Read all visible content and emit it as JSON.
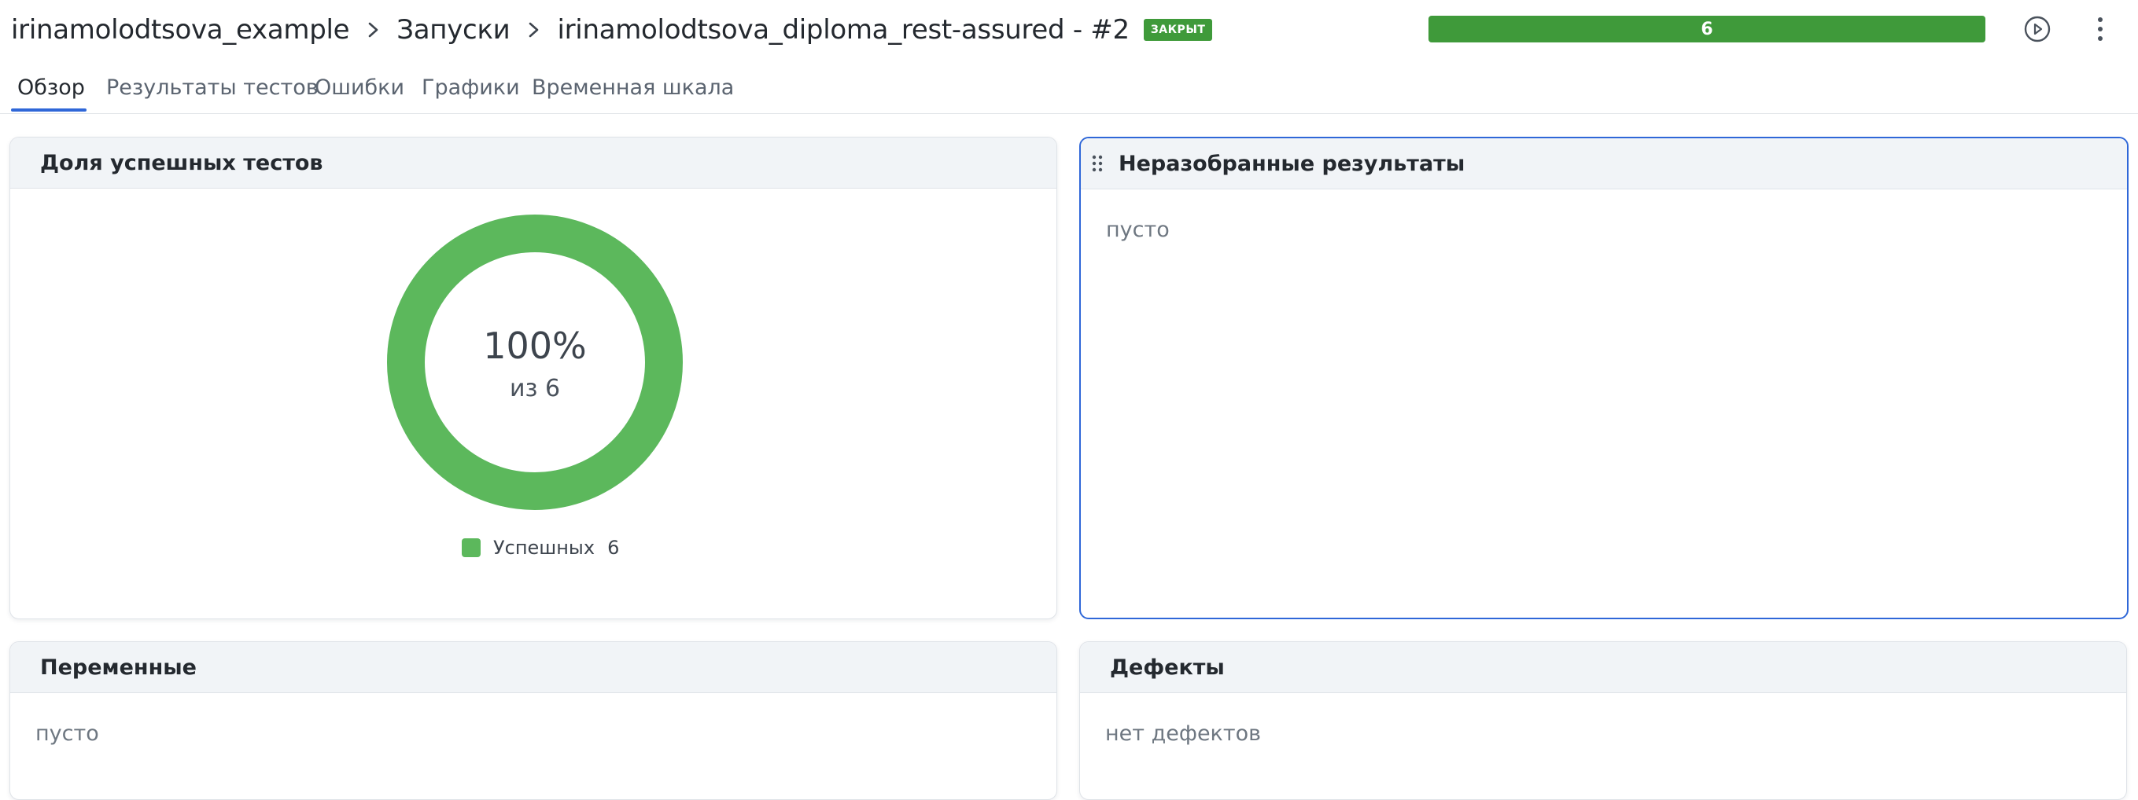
{
  "header": {
    "breadcrumbs": [
      "irinamolodtsova_example",
      "Запуски",
      "irinamolodtsova_diploma_rest-assured - #2"
    ],
    "status_badge": "ЗАКРЫТ",
    "progress_value": "6",
    "progress_fraction": 1.0
  },
  "tabs": [
    {
      "label": "Обзор",
      "active": true
    },
    {
      "label": "Результаты тестов",
      "active": false
    },
    {
      "label": "Ошибки",
      "active": false
    },
    {
      "label": "Графики",
      "active": false
    },
    {
      "label": "Временная шкала",
      "active": false
    }
  ],
  "widgets": {
    "success_rate": {
      "title": "Доля успешных тестов",
      "percent_text": "100%",
      "of_text": "из 6",
      "legend": [
        {
          "label": "Успешных",
          "count": "6",
          "color": "#5cb85c"
        }
      ]
    },
    "unprocessed": {
      "title": "Неразобранные результаты",
      "empty": "пусто"
    },
    "variables": {
      "title": "Переменные",
      "empty": "пусто"
    },
    "defects": {
      "title": "Дефекты",
      "empty": "нет дефектов"
    }
  },
  "chart_data": {
    "type": "pie",
    "categories": [
      "Успешных"
    ],
    "values": [
      6
    ],
    "colors": [
      "#5cb85c"
    ]
  },
  "icons": {
    "breadcrumb_separator": "chevron-right-icon",
    "run": "play-circle-icon",
    "more": "more-vertical-icon",
    "drag": "drag-handle-icon"
  },
  "colors": {
    "accent": "#2f67d8",
    "success": "#5cb85c",
    "status_badge": "#3f9a3a",
    "progress": "#3f9a3a"
  }
}
